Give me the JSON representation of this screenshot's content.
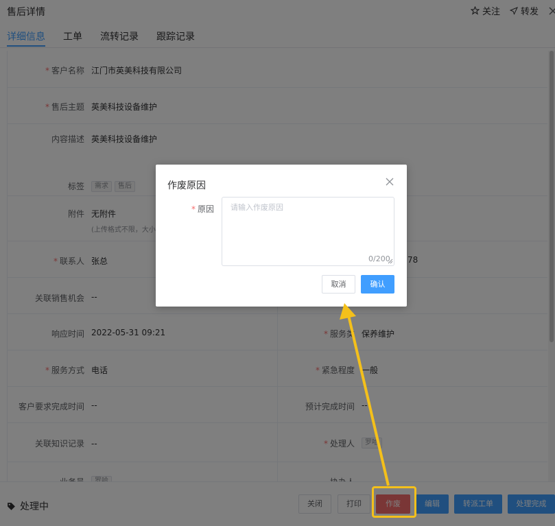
{
  "header": {
    "title": "售后详情",
    "follow_label": "关注",
    "forward_label": "转发"
  },
  "tabs": [
    {
      "label": "详细信息",
      "active": true
    },
    {
      "label": "工单",
      "active": false
    },
    {
      "label": "流转记录",
      "active": false
    },
    {
      "label": "跟踪记录",
      "active": false
    }
  ],
  "fields": {
    "customer_name": {
      "label": "客户名称",
      "value": "江门市英美科技有限公司",
      "required": true
    },
    "subject": {
      "label": "售后主题",
      "value": "英美科技设备维护",
      "required": true
    },
    "description": {
      "label": "内容描述",
      "value": "英美科技设备维护"
    },
    "tags": {
      "label": "标签",
      "values": [
        "需求",
        "售后"
      ]
    },
    "attachment": {
      "label": "附件",
      "value": "无附件",
      "hint": "(上传格式不限，大小"
    },
    "contact": {
      "label": "联系人",
      "value": "张总",
      "required": true,
      "right_value_partial": "78"
    },
    "opportunity": {
      "label": "关联销售机会",
      "value": "--"
    },
    "response_time": {
      "label": "响应时间",
      "value": "2022-05-31 09:21"
    },
    "service_type": {
      "label": "服务类型",
      "label_visible": "服务类",
      "value": "保养维护",
      "required": true
    },
    "service_mode": {
      "label": "服务方式",
      "value": "电话",
      "required": true
    },
    "urgency": {
      "label": "紧急程度",
      "value": "一般",
      "required": true
    },
    "customer_deadline": {
      "label": "客户要求完成时间",
      "value": "--"
    },
    "expected_finish": {
      "label": "预计完成时间",
      "value": "--"
    },
    "knowledge": {
      "label": "关联知识记录",
      "value": "--"
    },
    "handler": {
      "label": "处理人",
      "value": "罗哈",
      "required": true
    },
    "business": {
      "label": "业务员",
      "value": "罗哈"
    },
    "assistant": {
      "label": "协办人",
      "value": ""
    }
  },
  "footer": {
    "status": "处理中",
    "buttons": {
      "close": "关闭",
      "print": "打印",
      "void": "作废",
      "edit": "编辑",
      "dispatch": "转派工单",
      "complete": "处理完成"
    }
  },
  "dialog": {
    "title": "作废原因",
    "reason_label": "原因",
    "placeholder": "请输入作废原因",
    "counter": "0/200",
    "cancel": "取消",
    "confirm": "确认"
  },
  "colors": {
    "primary": "#409eff",
    "danger": "#f56c6c",
    "required": "#f56c6c",
    "highlight": "#f4c01b",
    "arrow": "#f4c01b"
  }
}
